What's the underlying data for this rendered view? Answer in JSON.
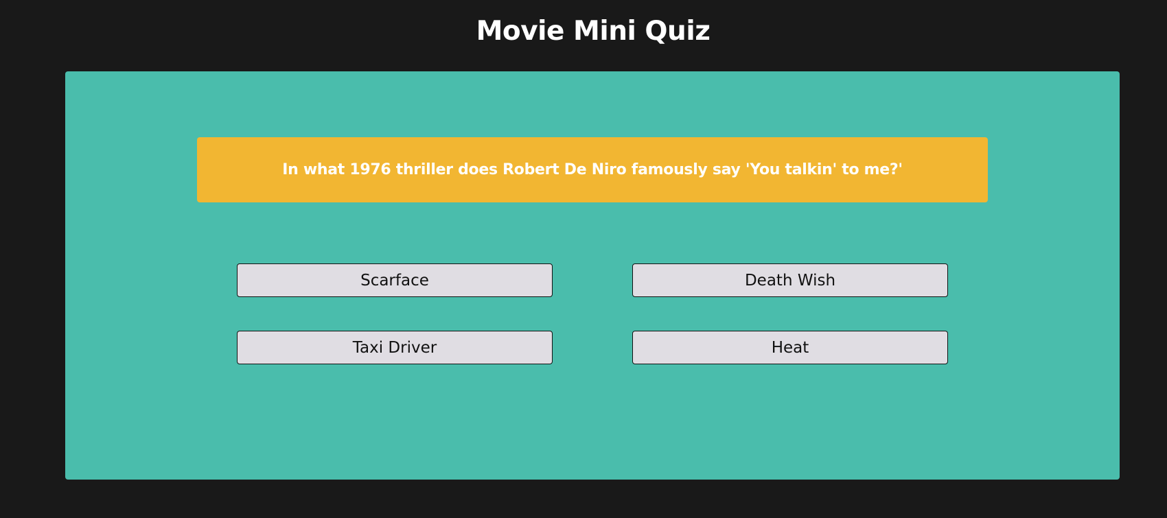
{
  "header": {
    "title": "Movie Mini Quiz"
  },
  "quiz": {
    "question": "In what 1976 thriller does Robert De Niro famously say 'You talkin' to me?'",
    "answers": [
      {
        "label": "Scarface"
      },
      {
        "label": "Death Wish"
      },
      {
        "label": "Taxi Driver"
      },
      {
        "label": "Heat"
      }
    ]
  },
  "colors": {
    "background": "#191919",
    "panel": "#4abdac",
    "question_box": "#f2b632",
    "button": "#e0dde3"
  }
}
